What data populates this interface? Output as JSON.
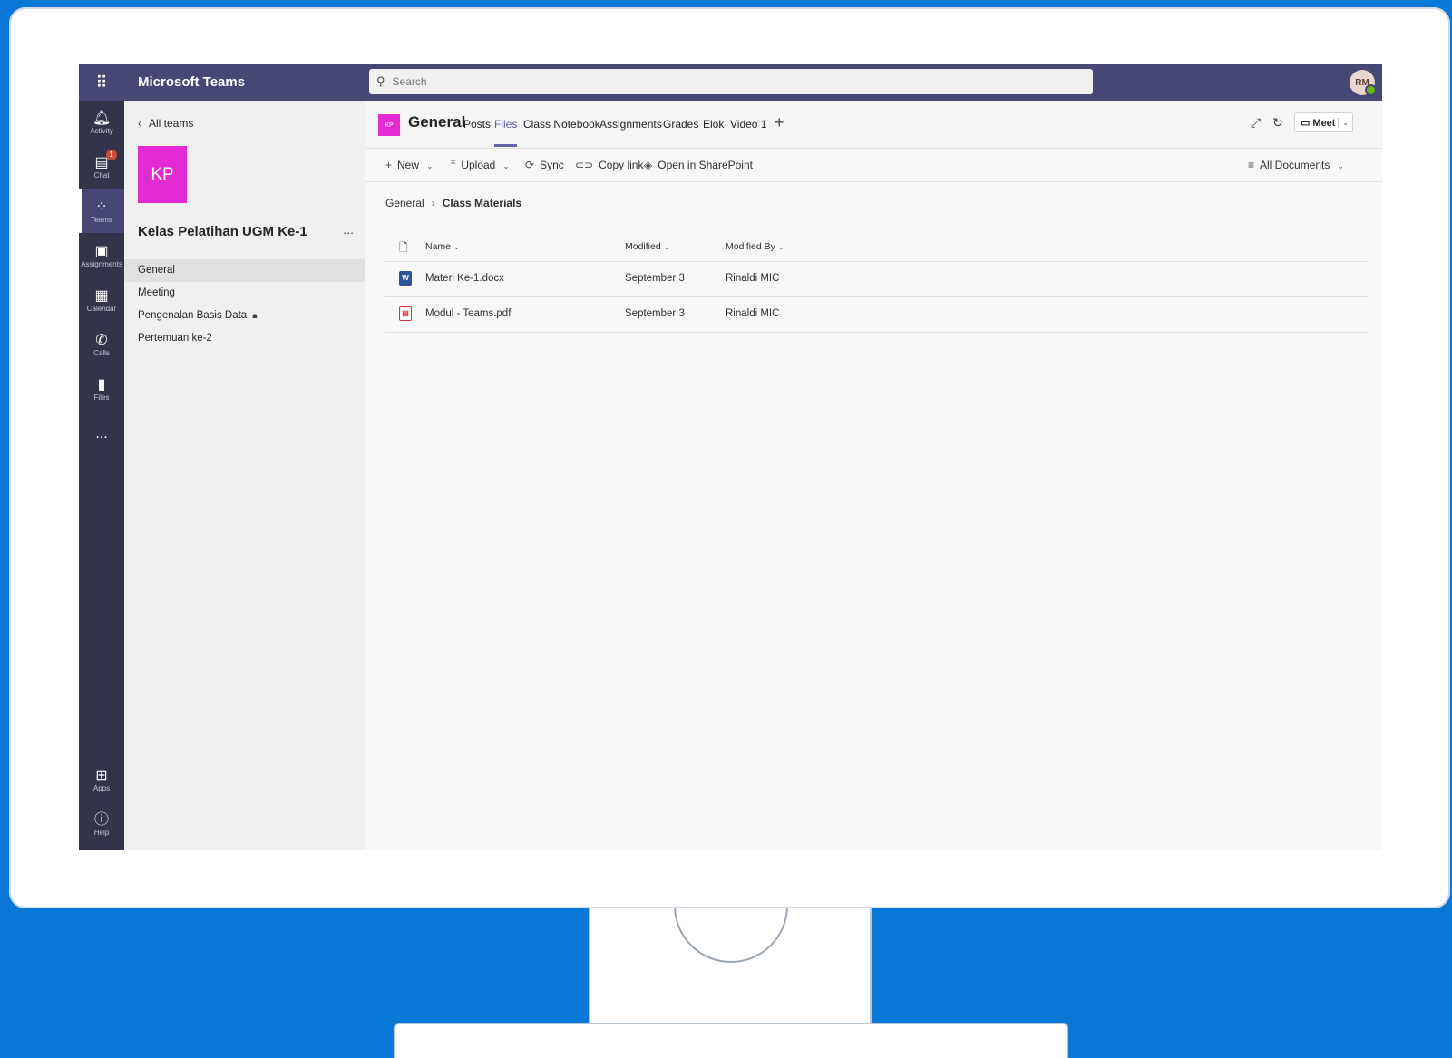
{
  "app": {
    "name": "Microsoft Teams",
    "avatar_initials": "RM"
  },
  "search": {
    "placeholder": "Search"
  },
  "rail": {
    "items": [
      {
        "label": "Activity",
        "icon": "bell-icon"
      },
      {
        "label": "Chat",
        "icon": "chat-icon",
        "badge": "1"
      },
      {
        "label": "Teams",
        "icon": "teams-icon"
      },
      {
        "label": "Assignments",
        "icon": "assignments-icon"
      },
      {
        "label": "Calendar",
        "icon": "calendar-icon"
      },
      {
        "label": "Calls",
        "icon": "phone-icon"
      },
      {
        "label": "Files",
        "icon": "file-icon"
      }
    ],
    "more": "...",
    "apps": "Apps",
    "help": "Help"
  },
  "team": {
    "back_label": "All teams",
    "logo_initials": "KP",
    "name": "Kelas Pelatihan UGM Ke-1",
    "more": "...",
    "channels": [
      {
        "label": "General"
      },
      {
        "label": "Meeting"
      },
      {
        "label": "Pengenalan Basis Data"
      },
      {
        "label": "Pertemuan ke-2"
      }
    ]
  },
  "channel_header": {
    "logo_initials": "KP",
    "title": "General",
    "tabs": [
      "Posts",
      "Files",
      "Class Notebook",
      "Assignments",
      "Grades",
      "Elok",
      "Video 1"
    ],
    "add": "+",
    "meet_label": "Meet"
  },
  "commands": {
    "new": "New",
    "upload": "Upload",
    "sync": "Sync",
    "copy_link": "Copy link",
    "open_sharepoint": "Open in SharePoint",
    "view": "All Documents"
  },
  "breadcrumb": {
    "root": "General",
    "current": "Class Materials"
  },
  "files": {
    "columns": {
      "name": "Name",
      "modified": "Modified",
      "modified_by": "Modified By"
    },
    "rows": [
      {
        "name": "Materi Ke-1.docx",
        "modified": "September 3",
        "modified_by": "Rinaldi MIC",
        "type": "word"
      },
      {
        "name": "Modul - Teams.pdf",
        "modified": "September 3",
        "modified_by": "Rinaldi MIC",
        "type": "pdf"
      }
    ]
  },
  "colors": {
    "titlebar": "#464775",
    "rail": "#33344a",
    "accent": "#6264a7",
    "team_logo": "#e32bd3"
  }
}
